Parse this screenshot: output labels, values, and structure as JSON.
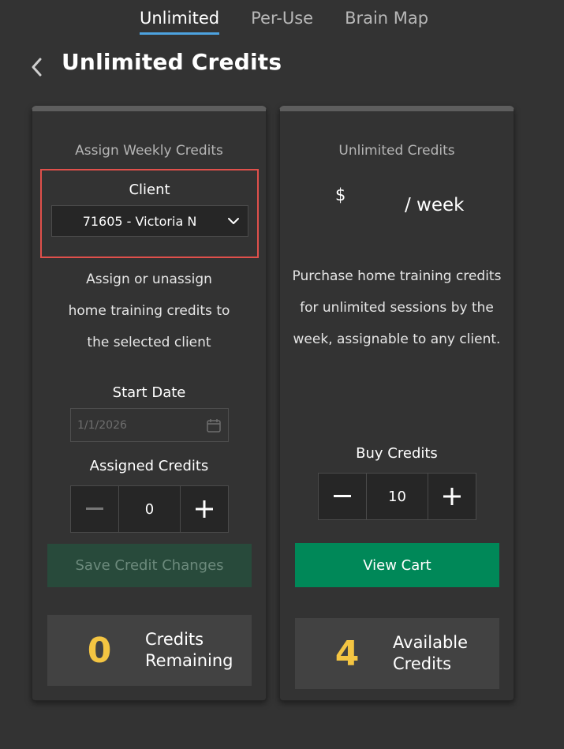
{
  "tabs": [
    {
      "label": "Unlimited",
      "active": true
    },
    {
      "label": "Per-Use",
      "active": false
    },
    {
      "label": "Brain Map",
      "active": false
    }
  ],
  "header": {
    "back_icon": "chevron-left-icon",
    "title": "Unlimited Credits"
  },
  "assign_card": {
    "header": "Assign Weekly Credits",
    "client_label": "Client",
    "client_value": "71605 - Victoria N",
    "description_lines": [
      "Assign or unassign",
      "home training credits to",
      "the selected client"
    ],
    "start_date_label": "Start Date",
    "start_date_value": "1/1/2026",
    "assigned_credits_label": "Assigned Credits",
    "assigned_credits_value": "0",
    "save_button": "Save Credit Changes",
    "remaining_count": "0",
    "remaining_label_1": "Credits",
    "remaining_label_2": "Remaining"
  },
  "purchase_card": {
    "header": "Unlimited Credits",
    "currency": "$",
    "per_week": "/ week",
    "description_lines": [
      "Purchase home training credits",
      "for unlimited sessions by the",
      "week, assignable to any client."
    ],
    "buy_credits_label": "Buy Credits",
    "buy_credits_value": "10",
    "view_cart_button": "View Cart",
    "available_count": "4",
    "available_label_1": "Available",
    "available_label_2": "Credits"
  },
  "colors": {
    "accent_tab": "#4da3e0",
    "highlight_border": "#e0504b",
    "count_yellow": "#f4c542",
    "cart_green": "#008858",
    "save_disabled": "#284a3b"
  }
}
